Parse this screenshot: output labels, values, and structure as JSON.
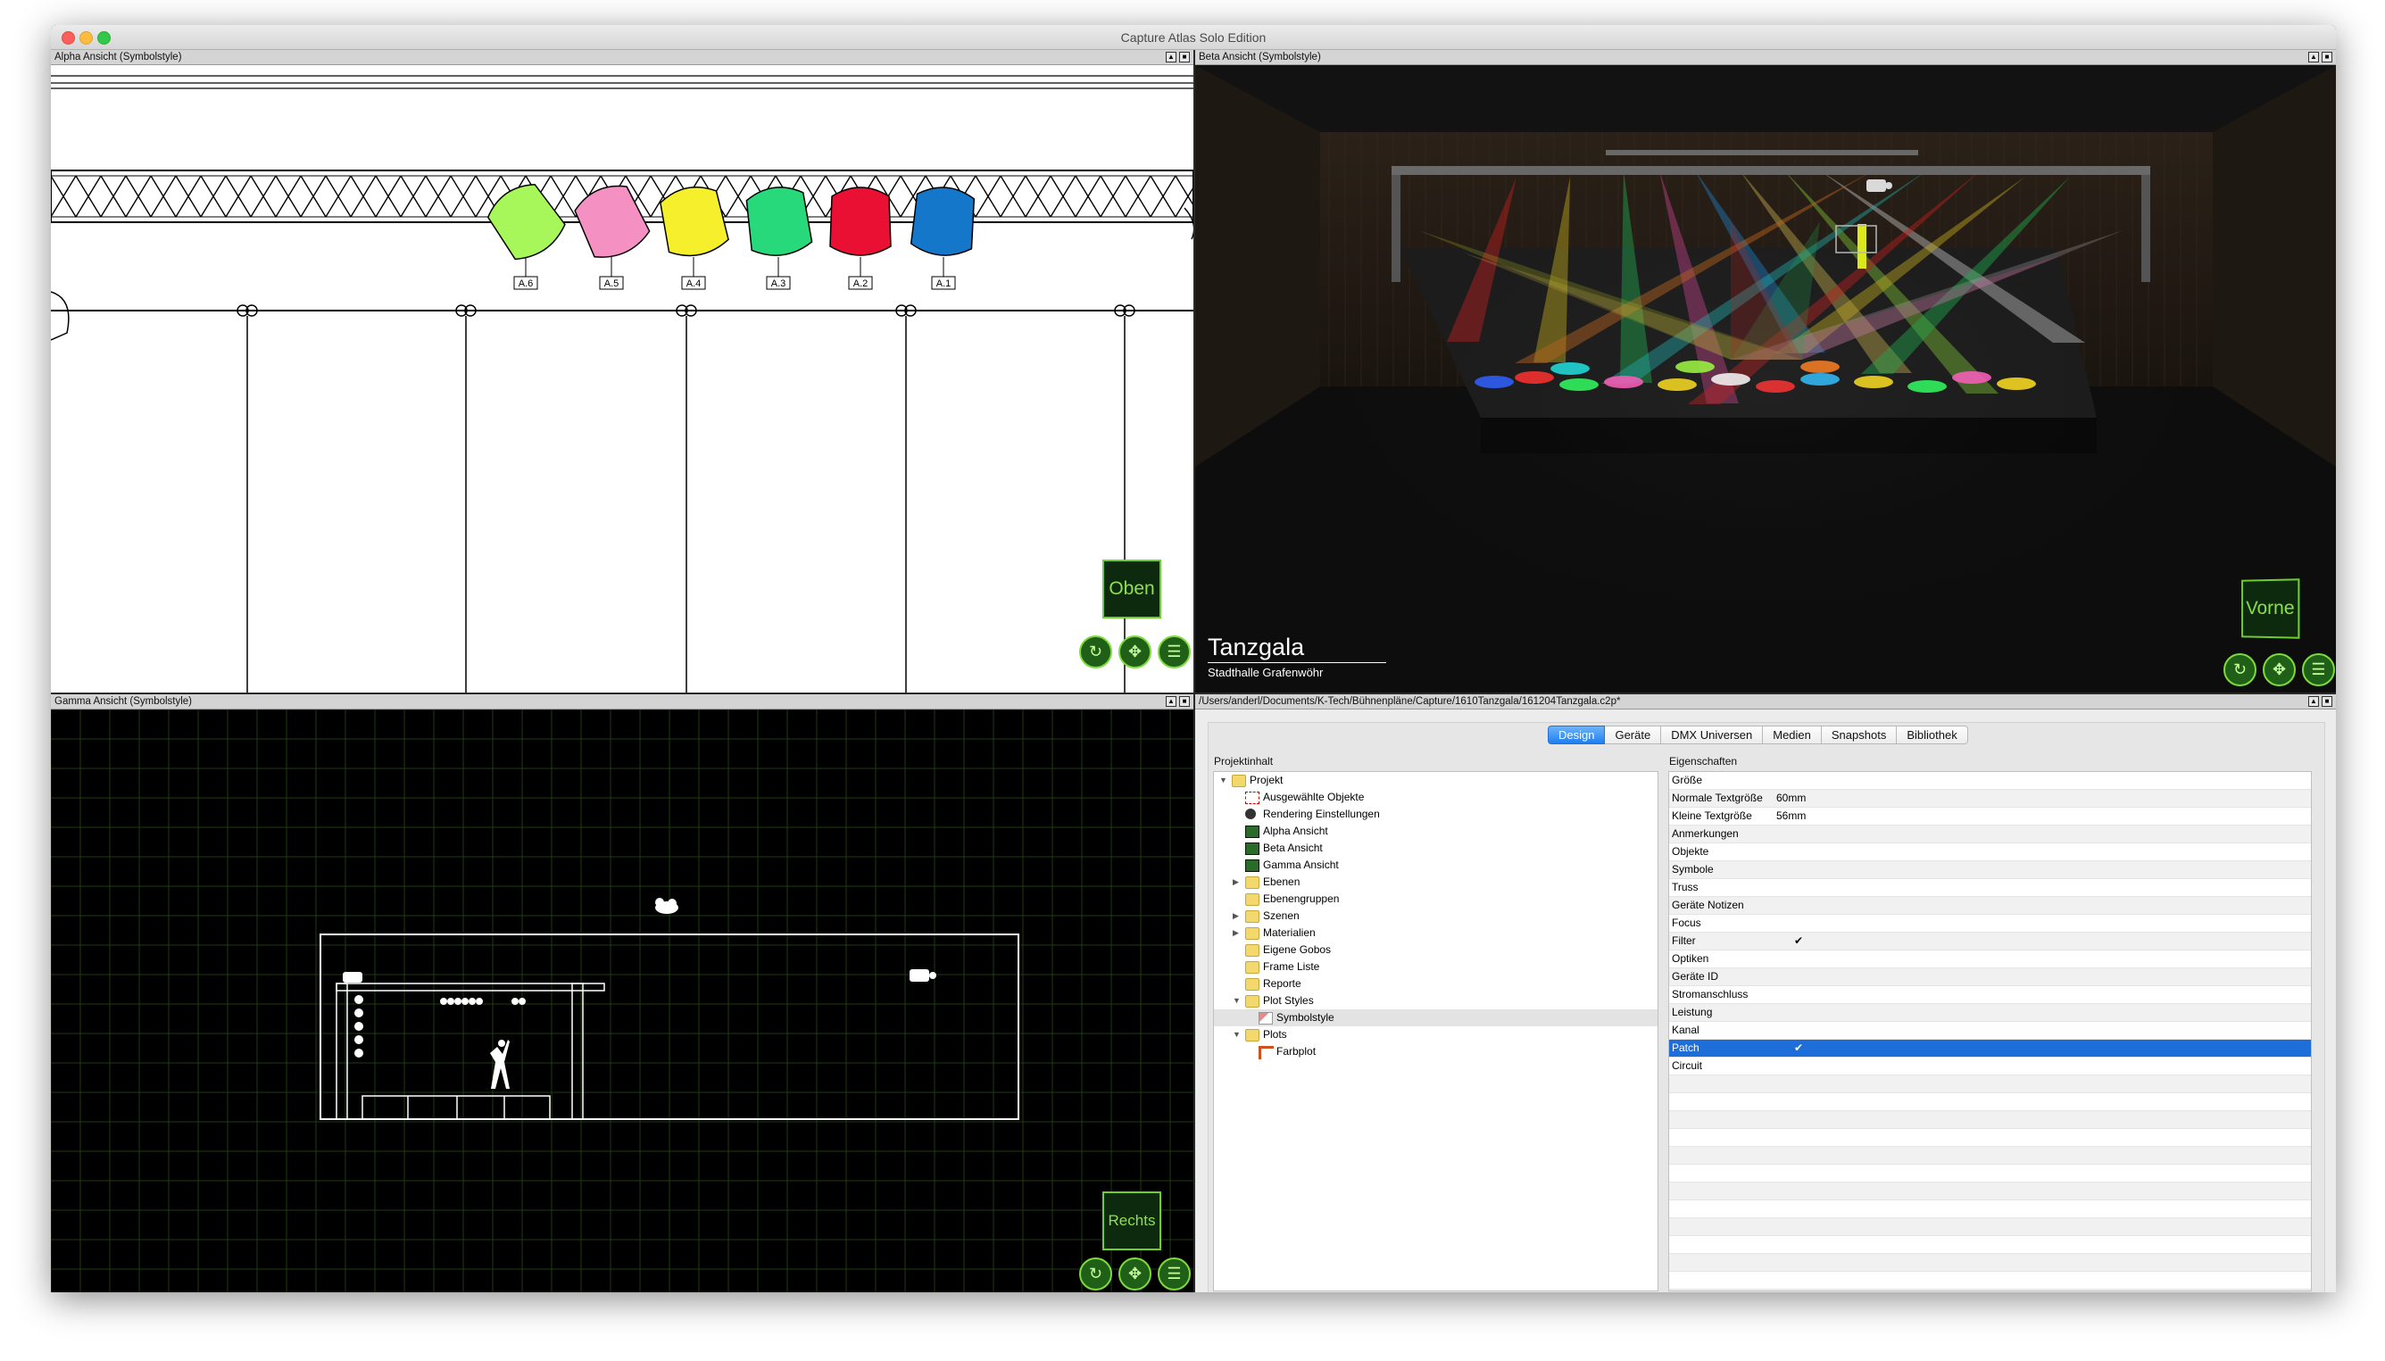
{
  "app": {
    "title": "Capture Atlas Solo Edition"
  },
  "alpha": {
    "title": "Alpha Ansicht  (Symbolstyle)",
    "view_label": "Oben",
    "fixtures": [
      {
        "label": "A.6",
        "color": "#a7f75a"
      },
      {
        "label": "A.5",
        "color": "#f590c2"
      },
      {
        "label": "A.4",
        "color": "#f6ef2c"
      },
      {
        "label": "A.3",
        "color": "#27d97a"
      },
      {
        "label": "A.2",
        "color": "#ea1033"
      },
      {
        "label": "A.1",
        "color": "#1577c9"
      }
    ]
  },
  "beta": {
    "title": "Beta Ansicht  (Symbolstyle)",
    "view_label": "Vorne",
    "show_title": "Tanzgala",
    "show_subtitle": "Stadthalle Grafenwöhr"
  },
  "gamma": {
    "title": "Gamma Ansicht  (Symbolstyle)",
    "view_label": "Rechts"
  },
  "project": {
    "path": "/Users/anderl/Documents/K-Tech/Bühnenpläne/Capture/1610Tanzgala/161204Tanzgala.c2p*",
    "tabs": [
      {
        "label": "Design",
        "active": true
      },
      {
        "label": "Geräte",
        "active": false
      },
      {
        "label": "DMX Universen",
        "active": false
      },
      {
        "label": "Medien",
        "active": false
      },
      {
        "label": "Snapshots",
        "active": false
      },
      {
        "label": "Bibliothek",
        "active": false
      }
    ],
    "content_header": "Projektinhalt",
    "properties_header": "Eigenschaften",
    "tree": [
      {
        "label": "Projekt",
        "level": 0,
        "arrow": "▼",
        "icon": "folder"
      },
      {
        "label": "Ausgewählte Objekte",
        "level": 1,
        "arrow": "",
        "icon": "selection"
      },
      {
        "label": "Rendering Einstellungen",
        "level": 1,
        "arrow": "",
        "icon": "render"
      },
      {
        "label": "Alpha Ansicht",
        "level": 1,
        "arrow": "",
        "icon": "view"
      },
      {
        "label": "Beta Ansicht",
        "level": 1,
        "arrow": "",
        "icon": "view"
      },
      {
        "label": "Gamma Ansicht",
        "level": 1,
        "arrow": "",
        "icon": "view"
      },
      {
        "label": "Ebenen",
        "level": 1,
        "arrow": "▶",
        "icon": "folder"
      },
      {
        "label": "Ebenengruppen",
        "level": 1,
        "arrow": "",
        "icon": "folder"
      },
      {
        "label": "Szenen",
        "level": 1,
        "arrow": "▶",
        "icon": "folder"
      },
      {
        "label": "Materialien",
        "level": 1,
        "arrow": "▶",
        "icon": "folder"
      },
      {
        "label": "Eigene Gobos",
        "level": 1,
        "arrow": "",
        "icon": "folder"
      },
      {
        "label": "Frame Liste",
        "level": 1,
        "arrow": "",
        "icon": "folder"
      },
      {
        "label": "Reporte",
        "level": 1,
        "arrow": "",
        "icon": "folder"
      },
      {
        "label": "Plot Styles",
        "level": 1,
        "arrow": "▼",
        "icon": "folder"
      },
      {
        "label": "Symbolstyle",
        "level": 2,
        "arrow": "",
        "icon": "style",
        "selected": true
      },
      {
        "label": "Plots",
        "level": 1,
        "arrow": "▼",
        "icon": "folder"
      },
      {
        "label": "Farbplot",
        "level": 2,
        "arrow": "",
        "icon": "plot"
      }
    ],
    "properties": [
      {
        "key": "Größe",
        "value": "",
        "check": false,
        "selected": false
      },
      {
        "key": "Normale Textgröße",
        "value": "60mm",
        "check": false,
        "selected": false
      },
      {
        "key": "Kleine Textgröße",
        "value": "56mm",
        "check": false,
        "selected": false
      },
      {
        "key": "Anmerkungen",
        "value": "",
        "check": false,
        "selected": false
      },
      {
        "key": "Objekte",
        "value": "",
        "check": false,
        "selected": false
      },
      {
        "key": "Symbole",
        "value": "",
        "check": false,
        "selected": false
      },
      {
        "key": "Truss",
        "value": "",
        "check": false,
        "selected": false
      },
      {
        "key": "Geräte Notizen",
        "value": "",
        "check": false,
        "selected": false
      },
      {
        "key": "Focus",
        "value": "",
        "check": false,
        "selected": false
      },
      {
        "key": "Filter",
        "value": "",
        "check": true,
        "selected": false
      },
      {
        "key": "Optiken",
        "value": "",
        "check": false,
        "selected": false
      },
      {
        "key": "Geräte ID",
        "value": "",
        "check": false,
        "selected": false
      },
      {
        "key": "Stromanschluss",
        "value": "",
        "check": false,
        "selected": false
      },
      {
        "key": "Leistung",
        "value": "",
        "check": false,
        "selected": false
      },
      {
        "key": "Kanal",
        "value": "",
        "check": false,
        "selected": false
      },
      {
        "key": "Patch",
        "value": "",
        "check": true,
        "selected": true
      },
      {
        "key": "Circuit",
        "value": "",
        "check": false,
        "selected": false
      }
    ]
  },
  "controls": {
    "orbit": "orbit-icon",
    "pan": "pan-icon",
    "menu": "menu-icon"
  },
  "colors": {
    "accent_green": "#7ddb3c",
    "selection_blue": "#1d6ed8"
  }
}
